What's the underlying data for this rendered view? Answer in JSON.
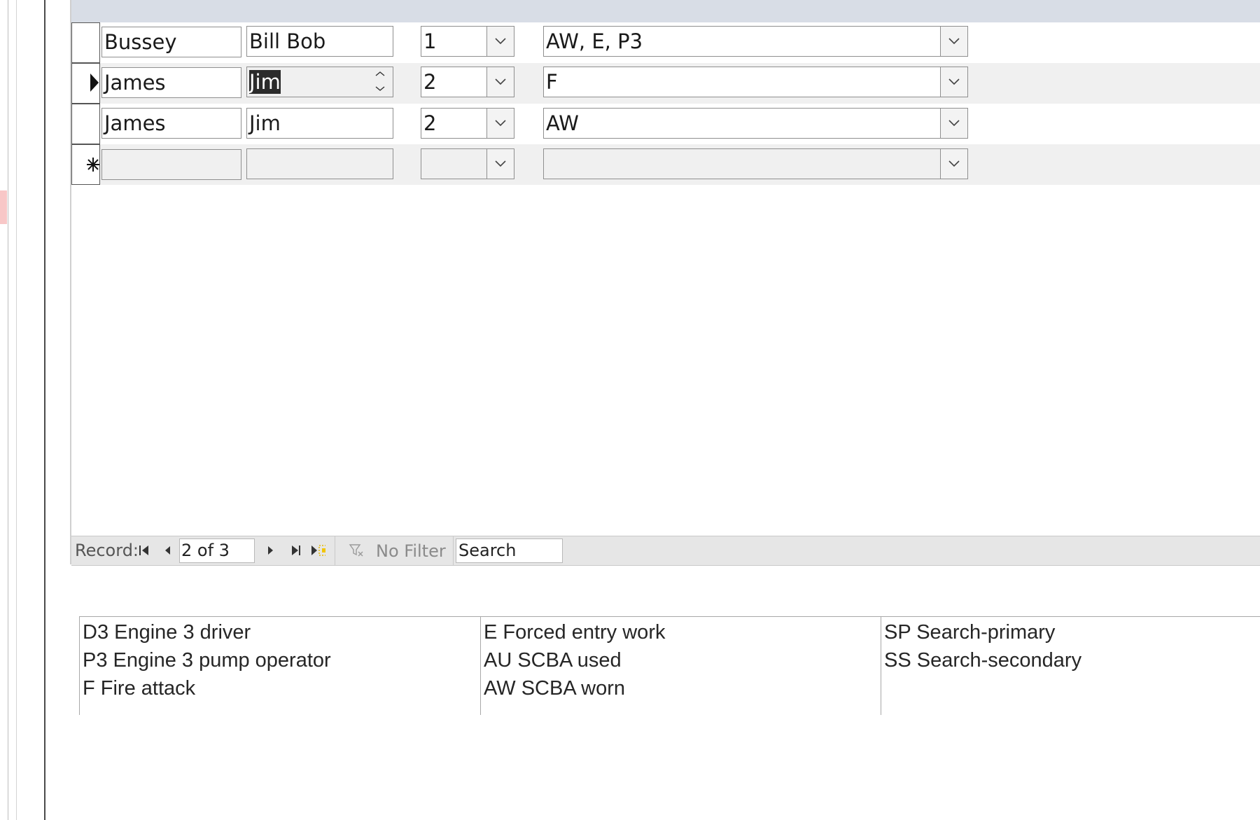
{
  "records": [
    {
      "last_name": "Bussey",
      "first_name": "Bill Bob",
      "number": "1",
      "codes": "AW, E, P3"
    },
    {
      "last_name": "James",
      "first_name": "Jim",
      "number": "2",
      "codes": "F"
    },
    {
      "last_name": "James",
      "first_name": "Jim",
      "number": "2",
      "codes": "AW"
    },
    {
      "last_name": "",
      "first_name": "",
      "number": "",
      "codes": ""
    }
  ],
  "selectors": {
    "current": "current-record-icon",
    "new": "new-record-icon"
  },
  "navigation": {
    "record_label": "Record:",
    "position": "2 of 3",
    "filter_label": "No Filter",
    "search_value": "Search"
  },
  "legend": {
    "col1": [
      "D3 Engine 3 driver",
      "P3 Engine 3 pump operator",
      "F Fire attack"
    ],
    "col2": [
      "E Forced entry work",
      "AU SCBA used",
      "AW SCBA worn"
    ],
    "col3": [
      "SP Search-primary",
      "SS Search-secondary"
    ]
  },
  "colors": {
    "header_band": "#d8dde6",
    "alt_row": "#f0f0f0",
    "selection": "#2b2b2b"
  }
}
